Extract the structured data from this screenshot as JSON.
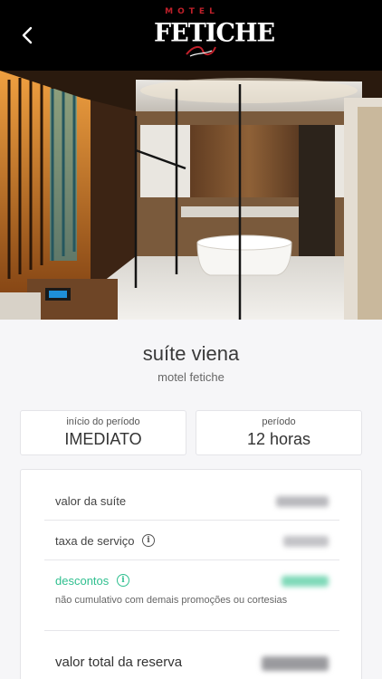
{
  "header": {
    "back_icon": "chevron-left-icon",
    "logo_top": "MOTEL",
    "logo_main": "FETICHE"
  },
  "gallery": {
    "image_count": 13,
    "active_index": 0
  },
  "room": {
    "name": "suíte viena",
    "motel": "motel fetiche"
  },
  "period_start": {
    "label": "início do período",
    "value": "IMEDIATO"
  },
  "period": {
    "label": "período",
    "value": "12 horas"
  },
  "summary": {
    "room_value_label": "valor da suíte",
    "service_fee_label": "taxa de serviço",
    "discounts_label": "descontos",
    "discounts_note": "não cumulativo com demais promoções ou cortesias",
    "total_label": "valor total da reserva",
    "room_value": "R$ 82,00",
    "service_fee": "R$ 4,00",
    "discounts": "-R$ 6,00",
    "total": "R$ 76,52"
  },
  "colors": {
    "accent_green": "#2fbf8f",
    "header_bg": "#000000",
    "logo_red": "#c0202a"
  }
}
